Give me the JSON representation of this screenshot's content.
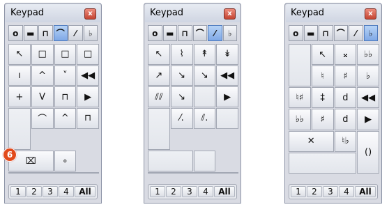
{
  "keypads": [
    {
      "title": "Keypad",
      "close_label": "x",
      "tabs": [
        {
          "label": "o"
        },
        {
          "label": "▬"
        },
        {
          "label": "⊓"
        },
        {
          "label": "⌒"
        },
        {
          "label": "⁄"
        },
        {
          "label": "♭"
        }
      ],
      "active_tab": 3,
      "keys": [
        "↖",
        "□",
        "□",
        "□",
        "ı",
        "^",
        "˅",
        "◀◀",
        "+",
        "V",
        "⊓",
        "▶",
        "⌒",
        "^",
        "⊓",
        "",
        "⌧",
        "∘",
        "",
        ""
      ],
      "layers": [
        "1",
        "2",
        "3",
        "4",
        "All"
      ]
    },
    {
      "title": "Keypad",
      "close_label": "x",
      "tabs": [
        {
          "label": "o"
        },
        {
          "label": "▬"
        },
        {
          "label": "⊓"
        },
        {
          "label": "⌒"
        },
        {
          "label": "⁄"
        },
        {
          "label": "♭"
        }
      ],
      "active_tab": 4,
      "keys": [
        "↖",
        "⌇",
        "↟",
        "↡",
        "↗",
        "↘",
        "↘",
        "◀◀",
        "⫽⫽",
        "↘",
        "",
        "▶",
        "⁄.",
        "⫽.",
        "",
        "",
        ""
      ],
      "layers": [
        "1",
        "2",
        "3",
        "4",
        "All"
      ]
    },
    {
      "title": "Keypad",
      "close_label": "x",
      "tabs": [
        {
          "label": "o"
        },
        {
          "label": "▬"
        },
        {
          "label": "⊓"
        },
        {
          "label": "⌒"
        },
        {
          "label": "⁄"
        },
        {
          "label": "♭"
        }
      ],
      "active_tab": 5,
      "keys": [
        "↖",
        "𝄪",
        "♭♭",
        "",
        "♮",
        "♯",
        "♭",
        "◀◀",
        "♮♯",
        "‡",
        "d",
        "▶",
        "♭♭",
        "♯",
        "d",
        "()",
        "✕",
        "♮♭",
        ""
      ],
      "layers": [
        "1",
        "2",
        "3",
        "4",
        "All"
      ]
    }
  ],
  "badge": {
    "label": "6"
  }
}
